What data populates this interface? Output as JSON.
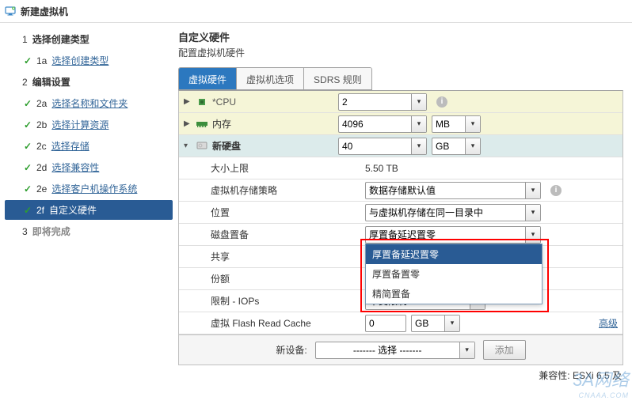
{
  "window": {
    "title": "新建虚拟机"
  },
  "sidebar": {
    "steps": [
      {
        "num": "1",
        "label": "选择创建类型",
        "type": "parent",
        "tick": false
      },
      {
        "num": "1a",
        "label": "选择创建类型",
        "type": "sub",
        "tick": true
      },
      {
        "num": "2",
        "label": "编辑设置",
        "type": "parent",
        "tick": false
      },
      {
        "num": "2a",
        "label": "选择名称和文件夹",
        "suffix": "",
        "type": "sub",
        "tick": true
      },
      {
        "num": "2b",
        "label": "选择计算资源",
        "type": "sub",
        "tick": true
      },
      {
        "num": "2c",
        "label": "选择存储",
        "type": "sub",
        "tick": true
      },
      {
        "num": "2d",
        "label": "选择兼容性",
        "type": "sub",
        "tick": true
      },
      {
        "num": "2e",
        "label": "选择客户机操作系统",
        "type": "sub",
        "tick": true
      },
      {
        "num": "2f",
        "label": "自定义硬件",
        "type": "sub",
        "tick": true,
        "selected": true
      },
      {
        "num": "3",
        "label": "即将完成",
        "type": "disabled",
        "tick": false
      }
    ]
  },
  "main": {
    "title": "自定义硬件",
    "subtitle": "配置虚拟机硬件",
    "tabs": [
      {
        "id": "hw",
        "label": "虚拟硬件",
        "active": true
      },
      {
        "id": "opt",
        "label": "虚拟机选项"
      },
      {
        "id": "sdrs",
        "label": "SDRS 规则"
      }
    ],
    "rows": {
      "cpu": {
        "label": "*CPU",
        "value": "2"
      },
      "memory": {
        "label": "内存",
        "value": "4096",
        "unit": "MB"
      },
      "newdisk": {
        "label": "新硬盘",
        "value": "40",
        "unit": "GB"
      },
      "sizelimit": {
        "label": "大小上限",
        "value": "5.50 TB"
      },
      "policy": {
        "label": "虚拟机存储策略",
        "value": "数据存储默认值"
      },
      "location": {
        "label": "位置",
        "value": "与虚拟机存储在同一目录中"
      },
      "provision": {
        "label": "磁盘置备",
        "value": "厚置备延迟置零",
        "options": [
          "厚置备延迟置零",
          "厚置备置零",
          "精简置备"
        ]
      },
      "sharing": {
        "label": "共享"
      },
      "shares": {
        "label": "份额"
      },
      "iops": {
        "label": "限制 - IOPs",
        "value": "不受限制"
      },
      "flash": {
        "label": "虚拟 Flash Read Cache",
        "value": "0",
        "unit": "GB",
        "advanced": "高级"
      }
    },
    "newdevice": {
      "label": "新设备:",
      "placeholder": "------- 选择 -------",
      "add": "添加"
    },
    "compat": {
      "label": "兼容性:",
      "value": "ESXi 6.5 及"
    }
  },
  "watermark": {
    "brand": "3A网络",
    "url": "CNAAA.COM"
  }
}
